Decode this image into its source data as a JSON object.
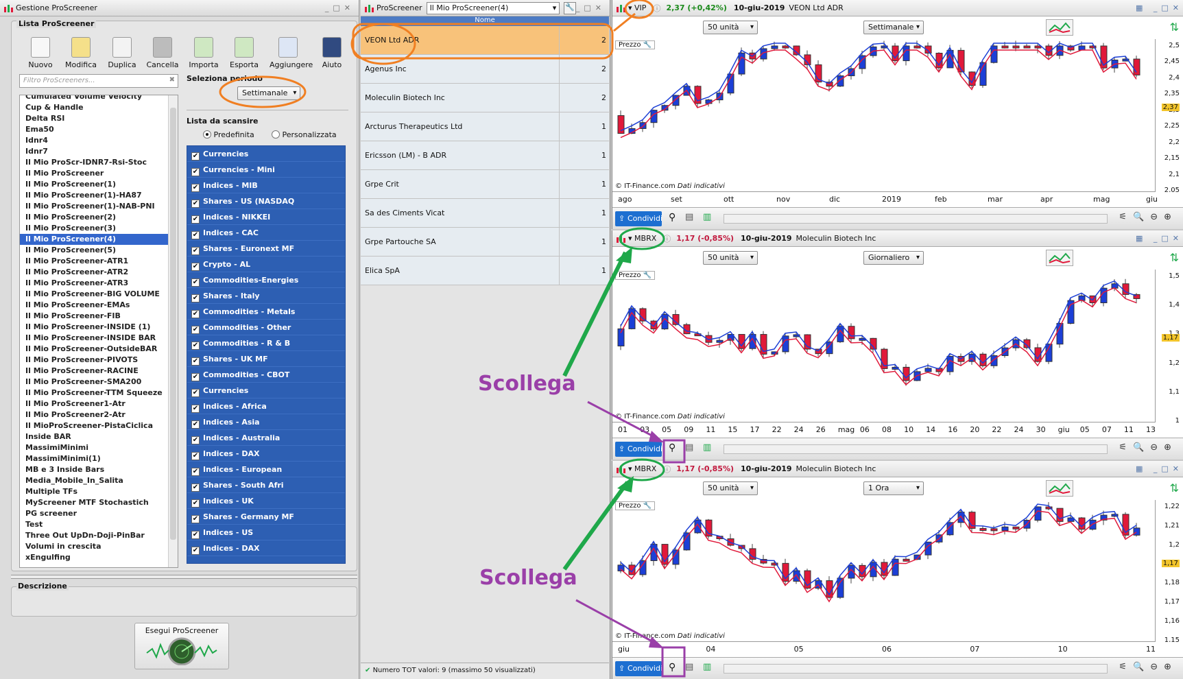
{
  "colors": {
    "orange": "#f07f22",
    "green": "#1fa84a",
    "purple": "#9a3fa8",
    "bull": "#1c3fd6",
    "bear": "#e0193a",
    "selection": "#3366cc"
  },
  "left": {
    "title": "Gestione ProScreener",
    "section_title": "Lista ProScreener",
    "toolbar": [
      {
        "label": "Nuovo",
        "icon": "new-doc-icon"
      },
      {
        "label": "Modifica",
        "icon": "edit-icon"
      },
      {
        "label": "Duplica",
        "icon": "duplicate-icon"
      },
      {
        "label": "Cancella",
        "icon": "trash-icon"
      },
      {
        "label": "Importa",
        "icon": "import-icon"
      },
      {
        "label": "Esporta",
        "icon": "export-icon"
      },
      {
        "label": "Aggiungere",
        "icon": "add-icon"
      },
      {
        "label": "Aiuto",
        "icon": "help-icon"
      }
    ],
    "filter_placeholder": "Filtro ProScreeners...",
    "period_label": "Seleziona periodo",
    "period_value": "Settimanale",
    "scan_list_title": "Lista da scansire",
    "radio": {
      "predefined": "Predefinita",
      "custom": "Personalizzata"
    },
    "screeners": [
      "Cumulated Volume Velocity",
      "Cup & Handle",
      "Delta RSI",
      "Ema50",
      "Idnr4",
      "Idnr7",
      "Il Mio ProScr-IDNR7-Rsi-Stoc",
      "Il Mio ProScreener",
      "Il Mio ProScreener(1)",
      "Il Mio ProScreener(1)-HA87",
      "Il Mio ProScreener(1)-NAB-PNI",
      "Il Mio ProScreener(2)",
      "Il Mio ProScreener(3)",
      "Il Mio ProScreener(4)",
      "Il Mio ProScreener(5)",
      "Il Mio ProScreener-ATR1",
      "Il Mio ProScreener-ATR2",
      "Il Mio ProScreener-ATR3",
      "Il Mio ProScreener-BIG VOLUME",
      "Il Mio ProScreener-EMAs",
      "Il Mio ProScreener-FIB",
      "Il Mio ProScreener-INSIDE  (1)",
      "Il Mio ProScreener-INSIDE  BAR",
      "Il Mio ProScreener-OutsideBAR",
      "Il Mio ProScreener-PIVOTS",
      "Il Mio ProScreener-RACINE",
      "Il Mio ProScreener-SMA200",
      "Il Mio ProScreener-TTM Squeeze",
      "Il Mio ProScreener1-Atr",
      "Il Mio ProScreener2-Atr",
      "Il MioProScreener-PistaCiclica",
      "Inside BAR",
      "MassimiMinimi",
      "MassimiMinimi(1)",
      "MB e 3 Inside Bars",
      "Media_Mobile_In_Salita",
      "Multiple TFs",
      "MyScreener MTF Stochastich",
      "PG screener",
      "Test",
      "Three Out UpDn-Doji-PinBar",
      "Volumi in crescita",
      "xEngulfing"
    ],
    "selected_index": 13,
    "favorite_index": 38,
    "scan_lists": [
      "Currencies",
      "Currencies - Mini",
      "Indices - MIB",
      "Shares - US (NASDAQ",
      "Indices - NIKKEI",
      "Indices - CAC",
      "Shares - Euronext MF",
      "Crypto - AL",
      "Commodities-Energies",
      "Shares - Italy",
      "Commodities - Metals",
      "Commodities - Other",
      "Commodities - R & B",
      "Shares - UK MF",
      "Commodities - CBOT",
      "Currencies",
      "Indices - Africa",
      "Indices - Asia",
      "Indices - Australia",
      "Indices - DAX",
      "Indices - European",
      "Shares - South Afri",
      "Indices - UK",
      "Shares - Germany MF",
      "Indices - US",
      "Indices - DAX"
    ],
    "description_label": "Descrizione",
    "run_label": "Esegui ProScreener"
  },
  "mid": {
    "title_prefix": "ProScreener",
    "title_select": "Il Mio ProScreener(4)",
    "col_name": "Nome",
    "results": [
      {
        "name": "VEON Ltd ADR",
        "count": "2"
      },
      {
        "name": "Agenus Inc",
        "count": "2"
      },
      {
        "name": "Moleculin Biotech Inc",
        "count": "2"
      },
      {
        "name": "Arcturus Therapeutics Ltd",
        "count": "1"
      },
      {
        "name": "Ericsson (LM) - B ADR",
        "count": "1"
      },
      {
        "name": "Grpe Crit",
        "count": "1"
      },
      {
        "name": "Sa des Ciments Vicat",
        "count": "1"
      },
      {
        "name": "Grpe Partouche SA",
        "count": "1"
      },
      {
        "name": "Elica SpA",
        "count": "1"
      }
    ],
    "status": "Numero TOT valori: 9 (massimo 50 visualizzati)"
  },
  "charts": [
    {
      "symbol": "VIP",
      "change": "2,37 (+0,42%)",
      "date": "10-giu-2019",
      "name": "VEON Ltd ADR",
      "units": "50 unità",
      "period": "Settimanale",
      "price_label": "Prezzo",
      "source": "© IT-Finance.com",
      "source_note": "Dati indicativi",
      "yticks": [
        "2,5",
        "2,45",
        "2,4",
        "2,35",
        "2,3",
        "2,25",
        "2,2",
        "2,15",
        "2,1",
        "2,05"
      ],
      "last": "2,37",
      "xticks": [
        "ago",
        "set",
        "ott",
        "nov",
        "dic",
        "2019",
        "feb",
        "mar",
        "apr",
        "mag",
        "giu"
      ],
      "share": "Condividi"
    },
    {
      "symbol": "MBRX",
      "change": "1,17 (-0,85%)",
      "date": "10-giu-2019",
      "name": "Moleculin Biotech Inc",
      "units": "50 unità",
      "period": "Giornaliero",
      "price_label": "Prezzo",
      "source": "© IT-Finance.com",
      "source_note": "Dati indicativi",
      "yticks": [
        "1,5",
        "1,4",
        "1,3",
        "1,2",
        "1,1",
        "1"
      ],
      "last": "1,17",
      "xticks": [
        "01",
        "03",
        "05",
        "09",
        "11",
        "15",
        "17",
        "22",
        "24",
        "26",
        "mag",
        "06",
        "08",
        "10",
        "14",
        "16",
        "20",
        "22",
        "24",
        "30",
        "giu",
        "05",
        "07",
        "11",
        "13"
      ],
      "share": "Condividi"
    },
    {
      "symbol": "MBRX",
      "change": "1,17 (-0,85%)",
      "date": "10-giu-2019",
      "name": "Moleculin Biotech Inc",
      "units": "50 unità",
      "period": "1 Ora",
      "price_label": "Prezzo",
      "source": "© IT-Finance.com",
      "source_note": "Dati indicativi",
      "yticks": [
        "1,22",
        "1,21",
        "1,2",
        "1,19",
        "1,18",
        "1,17",
        "1,16",
        "1,15"
      ],
      "last": "1,17",
      "xticks": [
        "giu",
        "04",
        "05",
        "06",
        "07",
        "10",
        "11"
      ],
      "share": "Condividi"
    }
  ],
  "annotations": {
    "label1": "Scollega",
    "label2": "Scollega"
  }
}
